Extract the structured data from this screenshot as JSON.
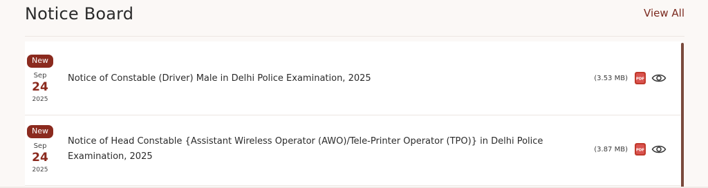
{
  "header": {
    "title": "Notice Board",
    "view_all_label": "View All"
  },
  "notices": [
    {
      "badge": "New",
      "month": "Sep",
      "day": "24",
      "year": "2025",
      "title": "Notice of Constable (Driver) Male in Delhi Police Examination, 2025",
      "size": "(3.53 MB)",
      "pdf_icon": "pdf-icon",
      "view_icon": "eye-icon"
    },
    {
      "badge": "New",
      "month": "Sep",
      "day": "24",
      "year": "2025",
      "title": "Notice of Head Constable {Assistant Wireless Operator (AWO)/Tele-Printer Operator (TPO)} in Delhi Police Examination, 2025",
      "size": "(3.87 MB)",
      "pdf_icon": "pdf-icon",
      "view_icon": "eye-icon"
    }
  ],
  "colors": {
    "accent": "#8b2a1e",
    "link": "#7b2a1f",
    "scrollbar": "#7a4a3c",
    "background": "#fbf8f6"
  }
}
